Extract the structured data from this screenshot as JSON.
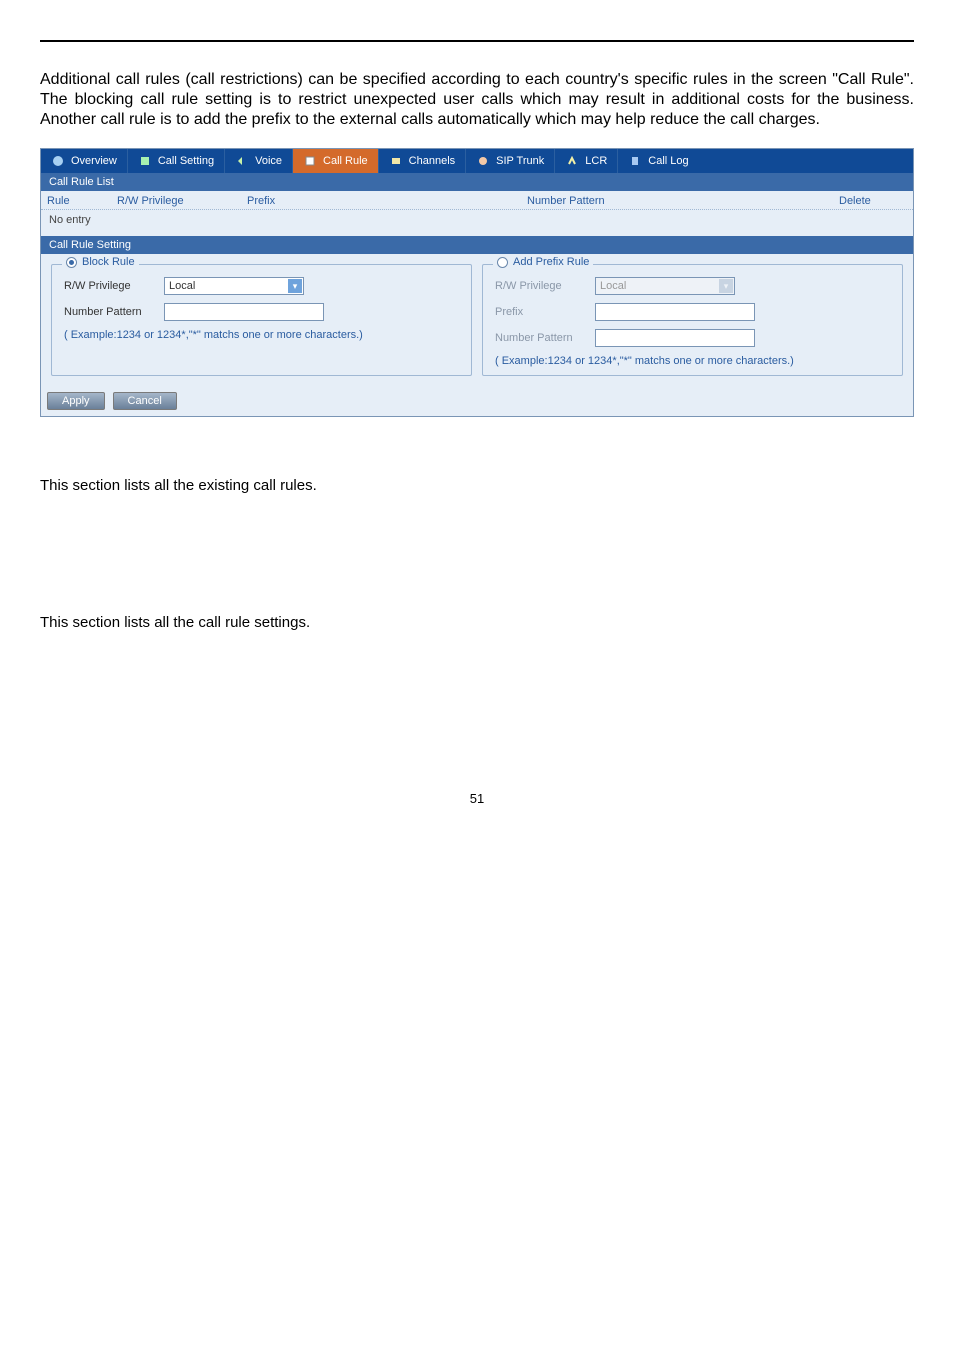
{
  "intro_text": "Additional call rules (call restrictions) can be specified according to each country's specific rules in the screen \"Call Rule\". The blocking call rule setting is to restrict unexpected user calls which may result in additional costs for the business. Another call rule is to add the prefix to the external calls automatically which may help reduce the call charges.",
  "tabs": {
    "overview": "Overview",
    "call_setting": "Call Setting",
    "voice": "Voice",
    "call_rule": "Call Rule",
    "channels": "Channels",
    "sip_trunk": "SIP Trunk",
    "lcr": "LCR",
    "call_log": "Call Log"
  },
  "list": {
    "title": "Call Rule List",
    "headers": {
      "rule": "Rule",
      "rw": "R/W Privilege",
      "prefix": "Prefix",
      "np": "Number Pattern",
      "del": "Delete"
    },
    "empty": "No entry"
  },
  "setting": {
    "title": "Call Rule Setting",
    "block": {
      "legend": "Block Rule",
      "rw_label": "R/W Privilege",
      "rw_value": "Local",
      "np_label": "Number Pattern",
      "example": "( Example:1234 or 1234*,\"*\" matchs one or more characters.)"
    },
    "prefix": {
      "legend": "Add Prefix Rule",
      "rw_label": "R/W Privilege",
      "rw_value": "Local",
      "pfx_label": "Prefix",
      "np_label": "Number Pattern",
      "example": "( Example:1234 or 1234*,\"*\" matchs one or more characters.)"
    }
  },
  "buttons": {
    "apply": "Apply",
    "cancel": "Cancel"
  },
  "notes": {
    "n1": "This section lists all the existing call rules.",
    "n2": "This section lists all the call rule settings."
  },
  "page_number": "51"
}
